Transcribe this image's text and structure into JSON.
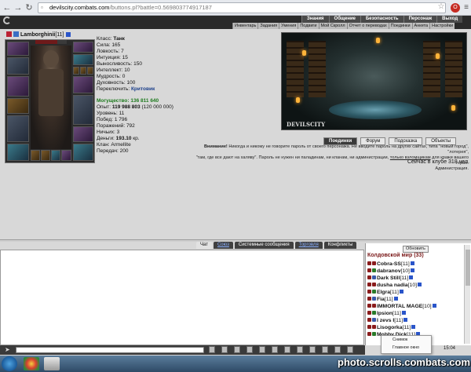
{
  "browser": {
    "url_host": "devilscity.combats.com",
    "url_rest": "/buttons.pl?battle=0.569803774917187",
    "nav": {
      "back": "←",
      "forward": "→",
      "reload": "↻"
    },
    "ext_label": "O"
  },
  "game": {
    "logo": "DEVILSCITY",
    "main_menu": [
      "Знания",
      "Общение",
      "Безопасность",
      "Персонаж",
      "Выход"
    ],
    "sub_menu": [
      "Инвентарь",
      "Задания",
      "Умения",
      "Подвиги",
      "Мой Скролл",
      "Отчет о переводах",
      "Поединки",
      "Анкета",
      "Настройки"
    ]
  },
  "character": {
    "name": "Lamborghinii",
    "level": "[11]",
    "stats": {
      "class": "Класс: ",
      "class_value": "Танк",
      "str": "Сила: 165",
      "agi": "Ловкость: 7",
      "int": "Интуиция: 15",
      "end": "Выносливость: 150",
      "intel": "Интеллект: 10",
      "wis": "Мудрость: 0",
      "spirit": "Духовность: 100",
      "switch": "Переключить: ",
      "switch_value": "Критовик",
      "might": "Могущество: 136 811 640",
      "exp_label": "Опыт: ",
      "exp_value": "119 988 803",
      "exp_next": " (120 000 000)",
      "lvl": "Уровень: 11",
      "wins": "Побед: 1 796",
      "losses": "Поражений: 792",
      "draws": "Ничьих: 3",
      "money_label": "Деньги: ",
      "money_value": "193.10",
      "money_unit": " кр.",
      "clan": "Клан: Armellite",
      "transfers": "Передач: 200"
    },
    "hp_fraction": 0.7
  },
  "scene": {
    "tag": "DEVILSCITY",
    "buttons": [
      "Поединки",
      "Форум",
      "Подсказка",
      "Объекты"
    ]
  },
  "warning": {
    "bold": "Внимание!",
    "line1": " Никогда и никому не говорите пароль от своего персонажа. Не вводите пароль на других сайтах, типа \"новый город\", \"лотерея\",",
    "line2": "\"там, где все дают на халяву\". Пароль не нужен ни паладинам, ни кланам, ни администрации, ",
    "link": "только взломщикам",
    "line3": " для кражи вашего героя.",
    "line4": "Администрация."
  },
  "online": "Сейчас в клубе 318 чел.",
  "chat": {
    "tabs": [
      "Чат",
      "Союз",
      "Системные сообщения",
      "Торговля",
      "Конфликты"
    ],
    "refresh": "Обновить",
    "world": "Колдовской мир (33)",
    "users": [
      {
        "name": "Cobra-SS",
        "level": "[11]"
      },
      {
        "name": "dabranov",
        "level": "[10]"
      },
      {
        "name": "Dark Still",
        "level": "[11]"
      },
      {
        "name": "dusha nadia",
        "level": "[10]"
      },
      {
        "name": "Elgra",
        "level": "[11]"
      },
      {
        "name": "Fia",
        "level": "[11]"
      },
      {
        "name": "IMMORTAL MAGE",
        "level": "[10]"
      },
      {
        "name": "Ipsion",
        "level": "[11]"
      },
      {
        "name": "I zevs I",
        "level": "[11]"
      },
      {
        "name": "Lisogorka",
        "level": "[11]"
      },
      {
        "name": "Mobby Dick",
        "level": "[11]"
      }
    ],
    "context_menu": [
      "Снимок",
      "Главное окно"
    ]
  },
  "watermark": "photo.scrolls.combats.com",
  "clock": "15:04"
}
